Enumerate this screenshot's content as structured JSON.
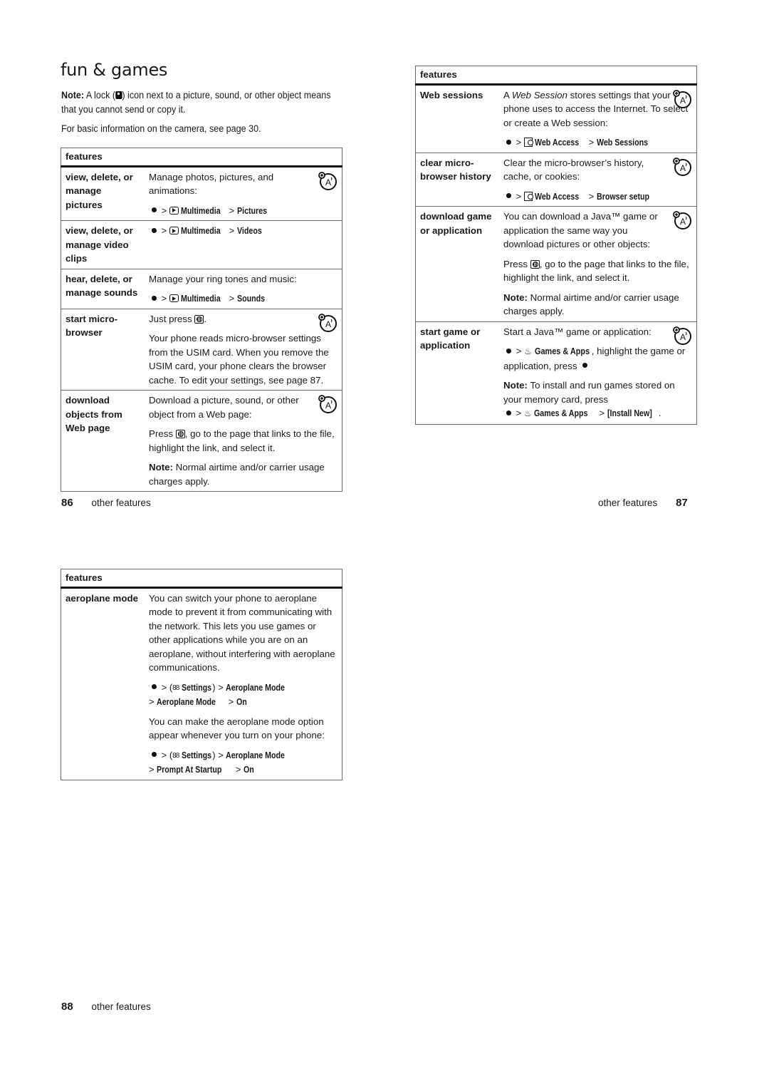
{
  "page86": {
    "title": "fun & games",
    "note_label": "Note:",
    "note_text_before": " A lock (",
    "note_text_after": ") icon next to a picture, sound, or other object means that you cannot send or copy it.",
    "camera_text": "For basic information on the camera, see page 30.",
    "table_header": "features",
    "rows": [
      {
        "name": "view, delete, or manage pictures",
        "desc": "Manage photos, pictures, and animations:",
        "path": {
          "icon": "multimedia-icon",
          "items": [
            "Multimedia",
            "Pictures"
          ]
        }
      },
      {
        "name": "view, delete, or manage video clips",
        "path": {
          "icon": "multimedia-icon",
          "items": [
            "Multimedia",
            "Videos"
          ]
        }
      },
      {
        "name": "hear, delete, or manage sounds",
        "desc": "Manage your ring tones and music:",
        "path": {
          "icon": "multimedia-icon",
          "items": [
            "Multimedia",
            "Sounds"
          ]
        }
      },
      {
        "name": "start micro-browser",
        "desc1": "Just press",
        "desc2": "Your phone reads micro-browser settings from the USIM card. When you remove the USIM card, your phone clears the browser cache. To edit your settings, see page 87."
      },
      {
        "name": "download objects from Web page",
        "desc1": "Download a picture, sound, or other object from a Web page:",
        "desc2_before": "Press",
        "desc2_after": ", go to the page that links to the file, highlight the link, and select it.",
        "note_label": "Note:",
        "note_text": " Normal airtime and/or carrier usage charges apply."
      }
    ],
    "footer": {
      "number": "86",
      "label": "other features"
    }
  },
  "page87": {
    "table_header": "features",
    "rows": [
      {
        "name": "Web sessions",
        "desc_a": "A ",
        "desc_italic": "Web Session",
        "desc_b": " stores settings that your phone uses to access the Internet. To select or create a Web session:",
        "path": {
          "icon": "web-access-icon",
          "items": [
            "Web Access",
            "Web Sessions"
          ]
        }
      },
      {
        "name": "clear micro-browser history",
        "desc": "Clear the micro-browser’s history, cache, or cookies:",
        "path": {
          "icon": "web-access-icon",
          "items": [
            "Web Access",
            "Browser setup"
          ]
        }
      },
      {
        "name": "download game or application",
        "desc1": "You can download a Java™ game or application the same way you download pictures or other objects:",
        "desc2_before": "Press",
        "desc2_after": ", go to the page that links to the file, highlight the link, and select it.",
        "note_label": "Note:",
        "note_text": " Normal airtime and/or carrier usage charges apply."
      },
      {
        "name": "start game or application",
        "desc1": "Start a Java™ game or application:",
        "path_item": "Games & Apps",
        "desc2_after": ", highlight the game or application, press",
        "note_label": "Note:",
        "note_text": " To install and run games stored on your memory card, press",
        "path2": {
          "icon": "games-icon",
          "items": [
            "Games & Apps",
            "[Install New]"
          ]
        }
      }
    ],
    "footer": {
      "number": "87",
      "label": "other features"
    }
  },
  "page88": {
    "table_header": "features",
    "rows": [
      {
        "name": "aeroplane mode",
        "desc1": "You can switch your phone to aeroplane mode to prevent it from communicating with the network. This lets you use games or other applications while you are on an aeroplane, without interfering with aeroplane communications.",
        "path1": [
          "Settings",
          "Aeroplane Mode",
          "Aeroplane Mode",
          "On"
        ],
        "desc2": "You can make the aeroplane mode option appear whenever you turn on your phone:",
        "path2": [
          "Settings",
          "Aeroplane Mode",
          "Prompt At Startup",
          "On"
        ]
      }
    ],
    "footer": {
      "number": "88",
      "label": "other features"
    }
  },
  "glyphs": {
    "separator": ">",
    "open_paren": "(",
    "close_paren": ")",
    "period": ".",
    "games_icon": "♨",
    "settings_icon": "88"
  }
}
